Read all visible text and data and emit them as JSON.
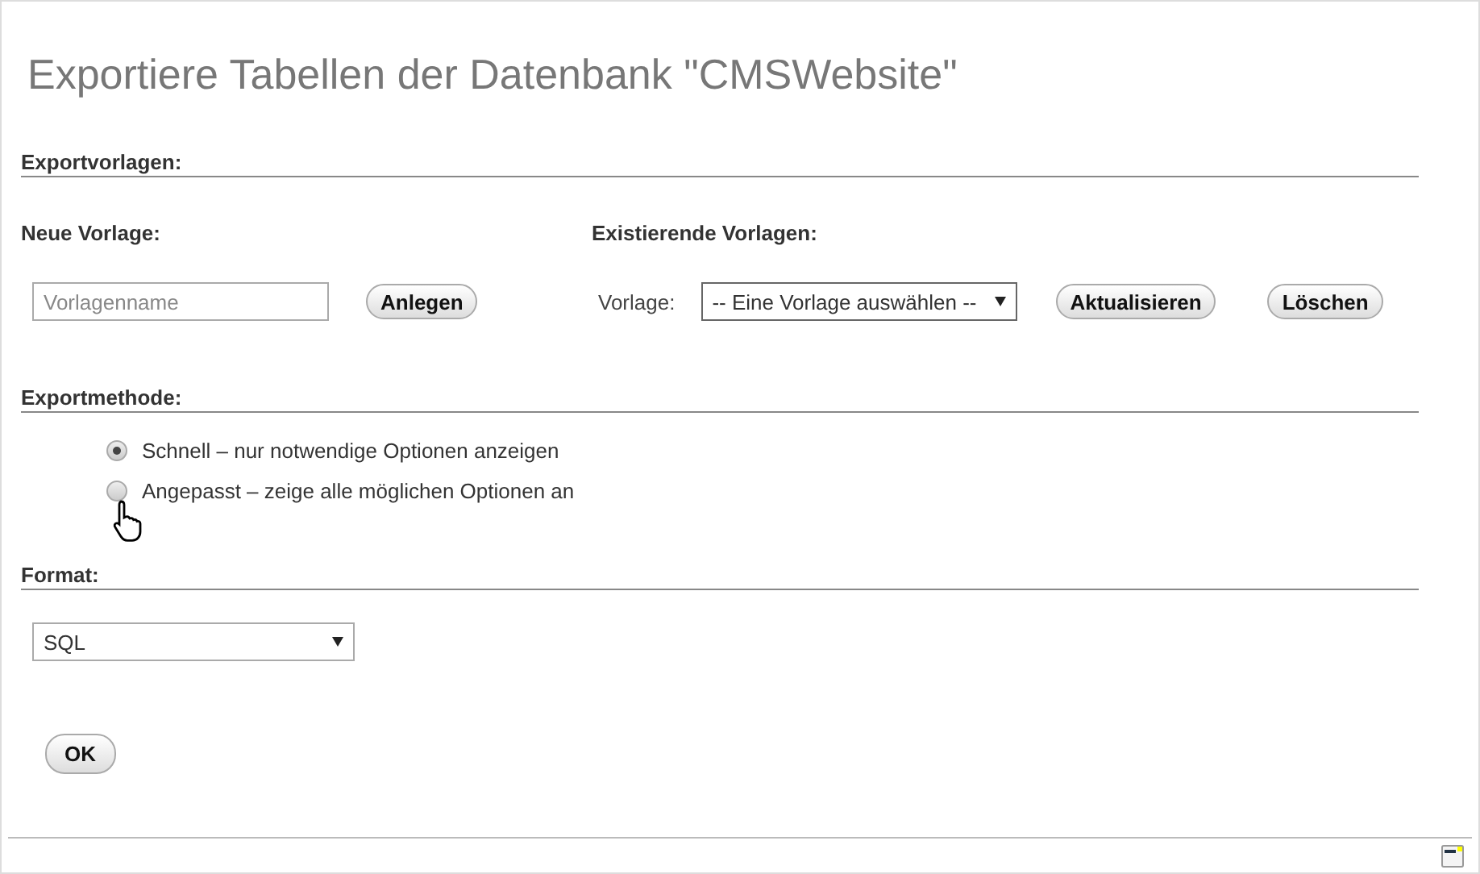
{
  "title": "Exportiere Tabellen der Datenbank \"CMSWebsite\"",
  "templates": {
    "heading": "Exportvorlagen:",
    "new": {
      "heading": "Neue Vorlage:",
      "placeholder": "Vorlagenname",
      "button": "Anlegen"
    },
    "existing": {
      "heading": "Existierende Vorlagen:",
      "label": "Vorlage:",
      "select": "-- Eine Vorlage auswählen --",
      "buttons": [
        "Aktualisieren",
        "Löschen"
      ]
    }
  },
  "method": {
    "heading": "Exportmethode:",
    "options": [
      {
        "label": "Schnell – nur notwendige Optionen anzeigen",
        "selected": true
      },
      {
        "label": "Angepasst – zeige alle möglichen Optionen an",
        "selected": false
      }
    ]
  },
  "format": {
    "heading": "Format:",
    "select": "SQL"
  },
  "buttons": [
    "OK"
  ]
}
